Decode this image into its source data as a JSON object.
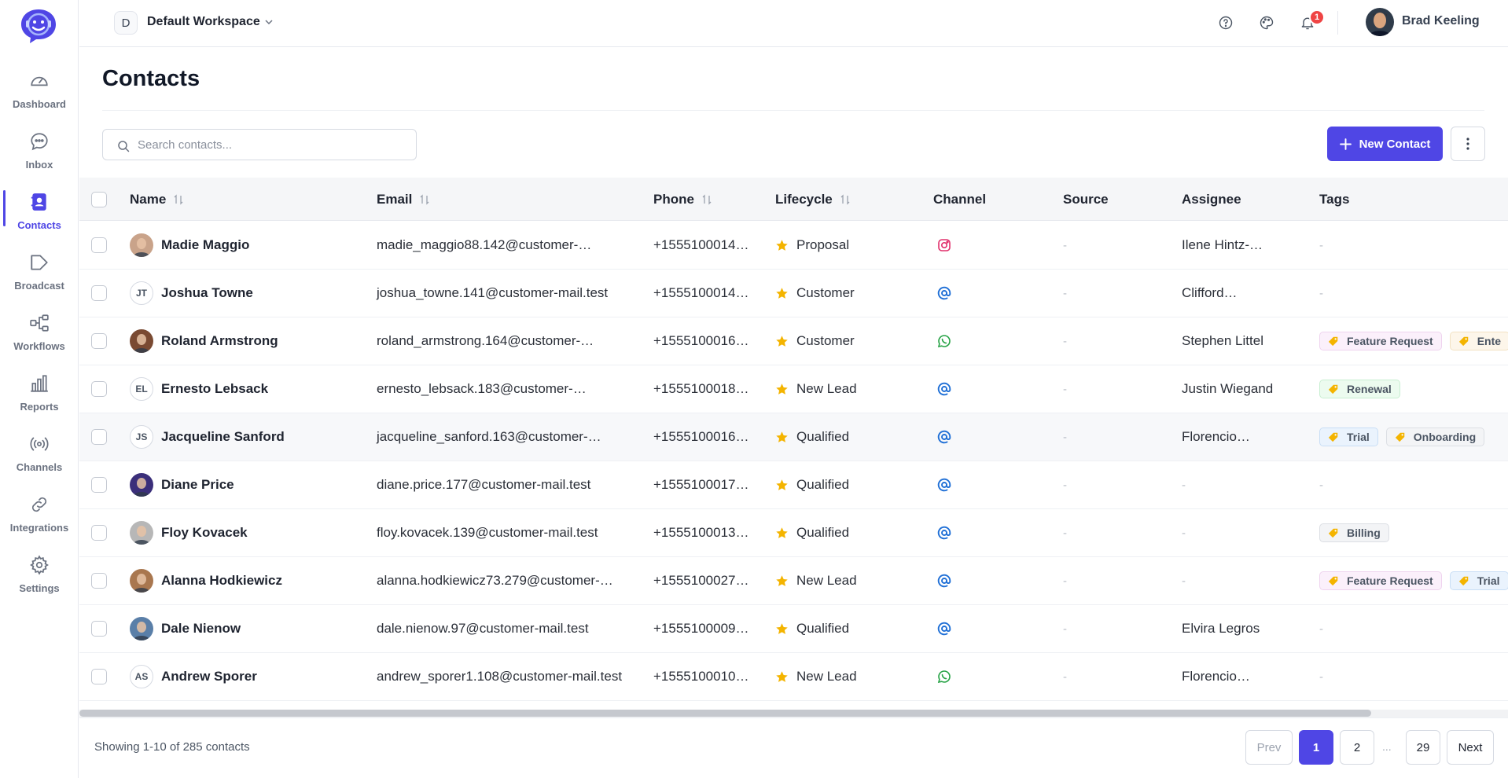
{
  "sidebar": {
    "items": [
      {
        "label": "Dashboard",
        "icon": "gauge-icon"
      },
      {
        "label": "Inbox",
        "icon": "chat-bubble-icon"
      },
      {
        "label": "Contacts",
        "icon": "contacts-book-icon",
        "active": true
      },
      {
        "label": "Broadcast",
        "icon": "megaphone-icon"
      },
      {
        "label": "Workflows",
        "icon": "workflow-icon"
      },
      {
        "label": "Reports",
        "icon": "bar-chart-icon"
      },
      {
        "label": "Channels",
        "icon": "broadcast-signal-icon"
      },
      {
        "label": "Integrations",
        "icon": "link-icon"
      },
      {
        "label": "Settings",
        "icon": "gear-icon"
      }
    ]
  },
  "topbar": {
    "workspace_initial": "D",
    "workspace_name": "Default Workspace",
    "notification_count": "1",
    "user_name": "Brad Keeling"
  },
  "page": {
    "title": "Contacts",
    "search_placeholder": "Search contacts...",
    "new_contact_label": "New Contact"
  },
  "table": {
    "columns": [
      "Name",
      "Email",
      "Phone",
      "Lifecycle",
      "Channel",
      "Source",
      "Assignee",
      "Tags"
    ],
    "rows": [
      {
        "name": "Madie Maggio",
        "initials": "",
        "email": "madie_maggio88.142@customer-…",
        "phone": "+1555100014…",
        "lifecycle": "Proposal",
        "channel": "instagram",
        "source": "-",
        "assignee": "Ilene Hintz-…",
        "tags": []
      },
      {
        "name": "Joshua Towne",
        "initials": "JT",
        "email": "joshua_towne.141@customer-mail.test",
        "phone": "+1555100014…",
        "lifecycle": "Customer",
        "channel": "email",
        "source": "-",
        "assignee": "Clifford…",
        "tags": []
      },
      {
        "name": "Roland Armstrong",
        "initials": "",
        "email": "roland_armstrong.164@customer-…",
        "phone": "+1555100016…",
        "lifecycle": "Customer",
        "channel": "whatsapp",
        "source": "-",
        "assignee": "Stephen Littel",
        "tags": [
          "Feature Request",
          "Ente"
        ]
      },
      {
        "name": "Ernesto Lebsack",
        "initials": "EL",
        "email": "ernesto_lebsack.183@customer-…",
        "phone": "+1555100018…",
        "lifecycle": "New Lead",
        "channel": "email",
        "source": "-",
        "assignee": "Justin Wiegand",
        "tags": [
          "Renewal"
        ]
      },
      {
        "name": "Jacqueline Sanford",
        "initials": "JS",
        "email": "jacqueline_sanford.163@customer-…",
        "phone": "+1555100016…",
        "lifecycle": "Qualified",
        "channel": "email",
        "source": "-",
        "assignee": "Florencio…",
        "tags": [
          "Trial",
          "Onboarding"
        ]
      },
      {
        "name": "Diane Price",
        "initials": "",
        "email": "diane.price.177@customer-mail.test",
        "phone": "+1555100017…",
        "lifecycle": "Qualified",
        "channel": "email",
        "source": "-",
        "assignee": "-",
        "tags": []
      },
      {
        "name": "Floy Kovacek",
        "initials": "",
        "email": "floy.kovacek.139@customer-mail.test",
        "phone": "+1555100013…",
        "lifecycle": "Qualified",
        "channel": "email",
        "source": "-",
        "assignee": "-",
        "tags": [
          "Billing"
        ]
      },
      {
        "name": "Alanna Hodkiewicz",
        "initials": "",
        "email": "alanna.hodkiewicz73.279@customer-…",
        "phone": "+1555100027…",
        "lifecycle": "New Lead",
        "channel": "email",
        "source": "-",
        "assignee": "-",
        "tags": [
          "Feature Request",
          "Trial"
        ]
      },
      {
        "name": "Dale Nienow",
        "initials": "",
        "email": "dale.nienow.97@customer-mail.test",
        "phone": "+1555100009…",
        "lifecycle": "Qualified",
        "channel": "email",
        "source": "-",
        "assignee": "Elvira Legros",
        "tags": []
      },
      {
        "name": "Andrew Sporer",
        "initials": "AS",
        "email": "andrew_sporer1.108@customer-mail.test",
        "phone": "+1555100010…",
        "lifecycle": "New Lead",
        "channel": "whatsapp",
        "source": "-",
        "assignee": "Florencio…",
        "tags": []
      }
    ]
  },
  "footer": {
    "showing_text": "Showing 1-10 of 285 contacts",
    "prev_label": "Prev",
    "pages": [
      "1",
      "2",
      "29"
    ],
    "ellipsis": "...",
    "next_label": "Next"
  },
  "colors": {
    "accent": "#4f46e5",
    "badge": "#ef4444",
    "instagram": "#e1306c",
    "whatsapp": "#25a244",
    "email": "#1f6fd6",
    "star": "#f4b400"
  }
}
